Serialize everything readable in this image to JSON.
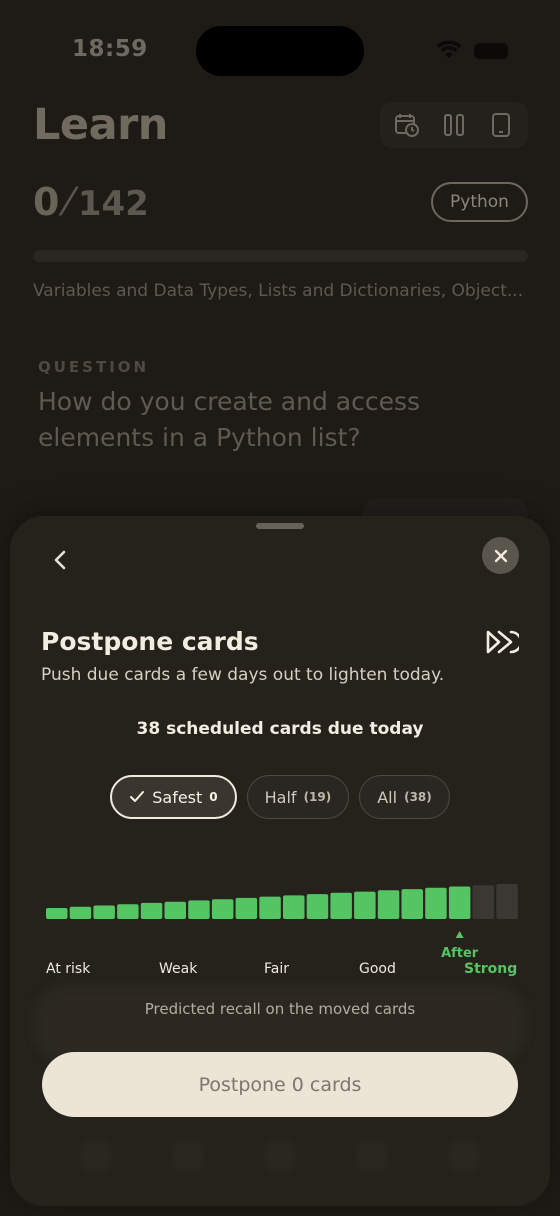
{
  "status_bar": {
    "time": "18:59"
  },
  "header": {
    "title": "Learn",
    "progress_done": "0",
    "progress_total": "142",
    "language_pill": "Python",
    "progress_fraction": 0,
    "topics": "Variables and Data Types, Lists and Dictionaries, Object..."
  },
  "question": {
    "label": "QUESTION",
    "text": "How do you create and access elements in a Python list?"
  },
  "sheet": {
    "title": "Postpone cards",
    "subtitle": "Push due cards a few days out to lighten today.",
    "due_count": "38 scheduled cards due today",
    "options": [
      {
        "label": "Safest",
        "count": "0",
        "selected": true
      },
      {
        "label": "Half",
        "count": "(19)",
        "selected": false
      },
      {
        "label": "All",
        "count": "(38)",
        "selected": false
      }
    ],
    "after_label": "After",
    "scale": [
      "At risk",
      "Weak",
      "Fair",
      "Good",
      "Strong"
    ],
    "caption": "Predicted recall on the moved cards",
    "cta": "Postpone 0 cards"
  },
  "colors": {
    "accent_green": "#55c463",
    "bar_inactive": "#3b3833",
    "cta_bg": "#ece4d4",
    "sheet_bg": "#25221c"
  },
  "icons": [
    "calendar-clock-icon",
    "columns-icon",
    "phone-icon",
    "back-chevron-icon",
    "close-icon",
    "skip-forward-icon",
    "check-icon"
  ],
  "chart_data": {
    "type": "bar",
    "bars_total": 20,
    "filled_bars": 18,
    "marker_bar_index": 17,
    "marker_label": "After",
    "levels": [
      "At risk",
      "Weak",
      "Fair",
      "Good",
      "Strong"
    ]
  }
}
